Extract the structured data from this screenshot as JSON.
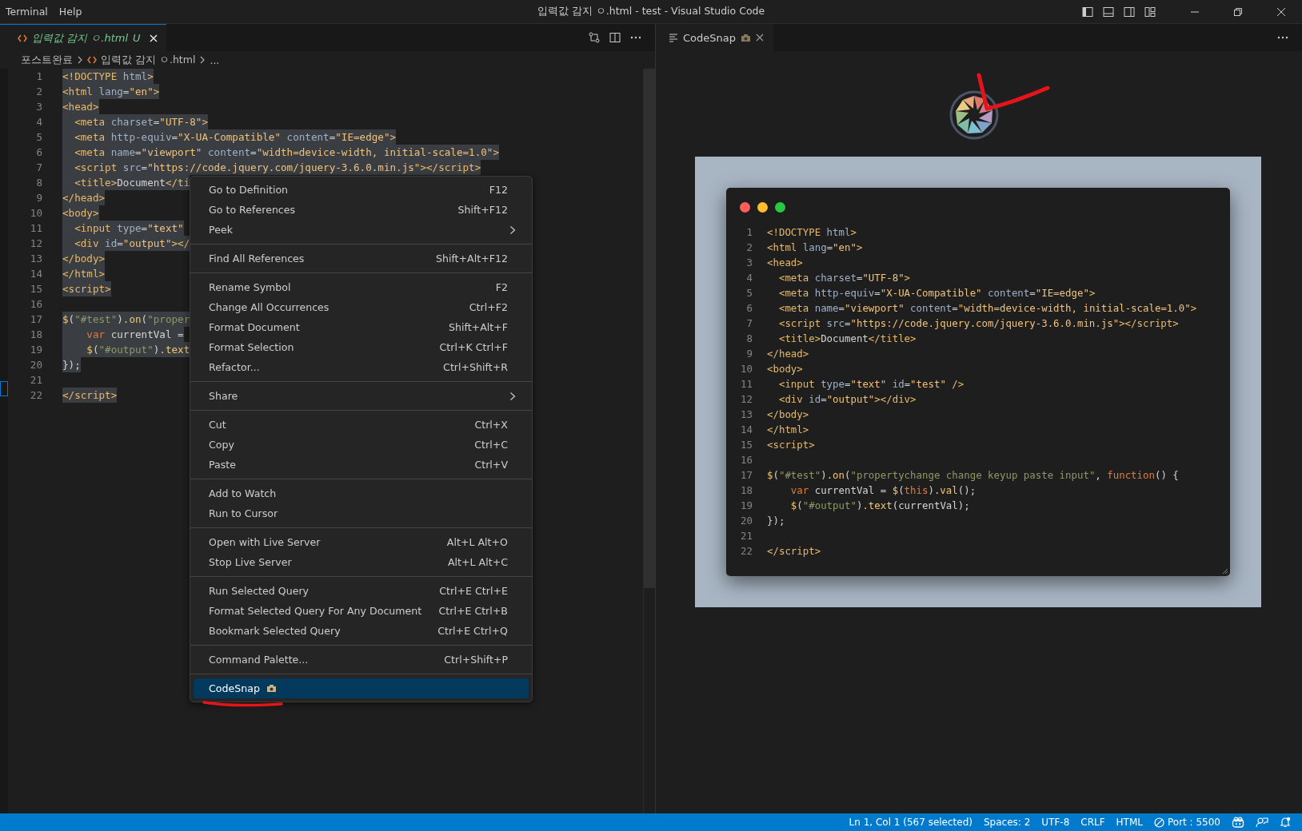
{
  "titlebar": {
    "menus": [
      "Terminal",
      "Help"
    ],
    "title": "입력값 감지 ㅇ.html - test - Visual Studio Code"
  },
  "editor": {
    "tab": {
      "label": "입력값 감지 ㅇ.html",
      "status": "U",
      "selected": true
    },
    "breadcrumb": [
      "포스트완료",
      "입력값 감지 ㅇ.html",
      "..."
    ],
    "selected": true,
    "lines": [
      {
        "n": "1",
        "tokens": [
          {
            "kind": "tag",
            "text": "<!DOCTYPE"
          },
          {
            "kind": "attr",
            "text": " html"
          },
          {
            "kind": "tag",
            "text": ">"
          }
        ]
      },
      {
        "n": "2",
        "tokens": [
          {
            "kind": "tag",
            "text": "<html"
          },
          {
            "kind": "attr",
            "text": " lang"
          },
          {
            "kind": "plain",
            "text": "="
          },
          {
            "kind": "string",
            "text": "\"en\""
          },
          {
            "kind": "tag",
            "text": ">"
          }
        ]
      },
      {
        "n": "3",
        "tokens": [
          {
            "kind": "tag",
            "text": "<head>"
          }
        ]
      },
      {
        "n": "4",
        "tokens": [
          {
            "kind": "tag",
            "text": "  <meta"
          },
          {
            "kind": "attr",
            "text": " charset"
          },
          {
            "kind": "plain",
            "text": "="
          },
          {
            "kind": "string",
            "text": "\"UTF-8\""
          },
          {
            "kind": "tag",
            "text": ">"
          }
        ]
      },
      {
        "n": "5",
        "tokens": [
          {
            "kind": "tag",
            "text": "  <meta"
          },
          {
            "kind": "attr",
            "text": " http-equiv"
          },
          {
            "kind": "plain",
            "text": "="
          },
          {
            "kind": "string",
            "text": "\"X-UA-Compatible\""
          },
          {
            "kind": "attr",
            "text": " content"
          },
          {
            "kind": "plain",
            "text": "="
          },
          {
            "kind": "string",
            "text": "\"IE=edge\""
          },
          {
            "kind": "tag",
            "text": ">"
          }
        ]
      },
      {
        "n": "6",
        "tokens": [
          {
            "kind": "tag",
            "text": "  <meta"
          },
          {
            "kind": "attr",
            "text": " name"
          },
          {
            "kind": "plain",
            "text": "="
          },
          {
            "kind": "string",
            "text": "\"viewport\""
          },
          {
            "kind": "attr",
            "text": " content"
          },
          {
            "kind": "plain",
            "text": "="
          },
          {
            "kind": "string",
            "text": "\"width=device-width, initial-scale=1.0\""
          },
          {
            "kind": "tag",
            "text": ">"
          }
        ]
      },
      {
        "n": "7",
        "tokens": [
          {
            "kind": "tag",
            "text": "  <script"
          },
          {
            "kind": "attr",
            "text": " src"
          },
          {
            "kind": "plain",
            "text": "="
          },
          {
            "kind": "string",
            "text": "\"https://code.jquery.com/jquery-3.6.0.min.js\""
          },
          {
            "kind": "tag",
            "text": "></script>"
          }
        ]
      },
      {
        "n": "8",
        "tokens": [
          {
            "kind": "tag",
            "text": "  <title>"
          },
          {
            "kind": "plain",
            "text": "Document"
          },
          {
            "kind": "tag",
            "text": "</ti"
          }
        ]
      },
      {
        "n": "9",
        "tokens": [
          {
            "kind": "tag",
            "text": "</head>"
          }
        ]
      },
      {
        "n": "10",
        "tokens": [
          {
            "kind": "tag",
            "text": "<body>"
          }
        ]
      },
      {
        "n": "11",
        "tokens": [
          {
            "kind": "tag",
            "text": "  <input"
          },
          {
            "kind": "attr",
            "text": " type"
          },
          {
            "kind": "plain",
            "text": "="
          },
          {
            "kind": "string",
            "text": "\"text\""
          }
        ]
      },
      {
        "n": "12",
        "tokens": [
          {
            "kind": "tag",
            "text": "  <div"
          },
          {
            "kind": "attr",
            "text": " id"
          },
          {
            "kind": "plain",
            "text": "="
          },
          {
            "kind": "string",
            "text": "\"output\""
          },
          {
            "kind": "tag",
            "text": "></"
          }
        ]
      },
      {
        "n": "13",
        "tokens": [
          {
            "kind": "tag",
            "text": "</body>"
          }
        ]
      },
      {
        "n": "14",
        "tokens": [
          {
            "kind": "tag",
            "text": "</html>"
          }
        ]
      },
      {
        "n": "15",
        "tokens": [
          {
            "kind": "tag",
            "text": "<script>"
          }
        ]
      },
      {
        "n": "16"
      },
      {
        "n": "17",
        "tokens": [
          {
            "kind": "method",
            "text": "$"
          },
          {
            "kind": "plain",
            "text": "("
          },
          {
            "kind": "jsstring",
            "text": "\"#test\""
          },
          {
            "kind": "plain",
            "text": ")"
          },
          {
            "kind": "method",
            "text": ".on"
          },
          {
            "kind": "plain",
            "text": "("
          },
          {
            "kind": "jsstring",
            "text": "\"proper"
          }
        ]
      },
      {
        "n": "18",
        "tokens": [
          {
            "kind": "keyword",
            "text": "    var"
          },
          {
            "kind": "plain",
            "text": " currentVal ="
          }
        ]
      },
      {
        "n": "19",
        "tokens": [
          {
            "kind": "method",
            "text": "    $"
          },
          {
            "kind": "plain",
            "text": "("
          },
          {
            "kind": "jsstring",
            "text": "\"#output\""
          },
          {
            "kind": "plain",
            "text": ")"
          },
          {
            "kind": "method",
            "text": ".text"
          }
        ]
      },
      {
        "n": "20",
        "tokens": [
          {
            "kind": "plain",
            "text": "});"
          }
        ]
      },
      {
        "n": "21"
      },
      {
        "n": "22",
        "tokens": [
          {
            "kind": "tag",
            "text": "</script>"
          }
        ]
      }
    ]
  },
  "context_menu": {
    "groups": [
      [
        {
          "label": "Go to Definition",
          "shortcut": "F12",
          "submenu": false,
          "selected": false
        },
        {
          "label": "Go to References",
          "shortcut": "Shift+F12",
          "submenu": false,
          "selected": false
        },
        {
          "label": "Peek",
          "submenu": true,
          "selected": false
        }
      ],
      [
        {
          "label": "Find All References",
          "shortcut": "Shift+Alt+F12",
          "submenu": false,
          "selected": false
        }
      ],
      [
        {
          "label": "Rename Symbol",
          "shortcut": "F2",
          "submenu": false,
          "selected": false
        },
        {
          "label": "Change All Occurrences",
          "shortcut": "Ctrl+F2",
          "submenu": false,
          "selected": false
        },
        {
          "label": "Format Document",
          "shortcut": "Shift+Alt+F",
          "submenu": false,
          "selected": false
        },
        {
          "label": "Format Selection",
          "shortcut": "Ctrl+K Ctrl+F",
          "submenu": false,
          "selected": false
        },
        {
          "label": "Refactor...",
          "shortcut": "Ctrl+Shift+R",
          "submenu": false,
          "selected": false
        }
      ],
      [
        {
          "label": "Share",
          "submenu": true,
          "selected": false
        }
      ],
      [
        {
          "label": "Cut",
          "shortcut": "Ctrl+X",
          "submenu": false,
          "selected": false
        },
        {
          "label": "Copy",
          "shortcut": "Ctrl+C",
          "submenu": false,
          "selected": false
        },
        {
          "label": "Paste",
          "shortcut": "Ctrl+V",
          "submenu": false,
          "selected": false
        }
      ],
      [
        {
          "label": "Add to Watch",
          "submenu": false,
          "selected": false
        },
        {
          "label": "Run to Cursor",
          "submenu": false,
          "selected": false
        }
      ],
      [
        {
          "label": "Open with Live Server",
          "shortcut": "Alt+L Alt+O",
          "submenu": false,
          "selected": false
        },
        {
          "label": "Stop Live Server",
          "shortcut": "Alt+L Alt+C",
          "submenu": false,
          "selected": false
        }
      ],
      [
        {
          "label": "Run Selected Query",
          "shortcut": "Ctrl+E Ctrl+E",
          "submenu": false,
          "selected": false
        },
        {
          "label": "Format Selected Query For Any Document",
          "shortcut": "Ctrl+E Ctrl+B",
          "submenu": false,
          "selected": false
        },
        {
          "label": "Bookmark Selected Query",
          "shortcut": "Ctrl+E Ctrl+Q",
          "submenu": false,
          "selected": false
        }
      ],
      [
        {
          "label": "Command Palette...",
          "shortcut": "Ctrl+Shift+P",
          "submenu": false,
          "selected": false
        }
      ],
      [
        {
          "label": "CodeSnap",
          "submenu": false,
          "selected": true,
          "icon": true
        }
      ]
    ]
  },
  "codesnap": {
    "tab": {
      "label": "CodeSnap",
      "selected": true
    },
    "lines": [
      {
        "n": "1",
        "tokens": [
          {
            "kind": "tag",
            "text": "<!DOCTYPE"
          },
          {
            "kind": "attr",
            "text": " html"
          },
          {
            "kind": "tag",
            "text": ">"
          }
        ]
      },
      {
        "n": "2",
        "tokens": [
          {
            "kind": "tag",
            "text": "<html"
          },
          {
            "kind": "attr",
            "text": " lang"
          },
          {
            "kind": "plain",
            "text": "="
          },
          {
            "kind": "string",
            "text": "\"en\""
          },
          {
            "kind": "tag",
            "text": ">"
          }
        ]
      },
      {
        "n": "3",
        "tokens": [
          {
            "kind": "tag",
            "text": "<head>"
          }
        ]
      },
      {
        "n": "4",
        "tokens": [
          {
            "kind": "tag",
            "text": "  <meta"
          },
          {
            "kind": "attr",
            "text": " charset"
          },
          {
            "kind": "plain",
            "text": "="
          },
          {
            "kind": "string",
            "text": "\"UTF-8\""
          },
          {
            "kind": "tag",
            "text": ">"
          }
        ]
      },
      {
        "n": "5",
        "tokens": [
          {
            "kind": "tag",
            "text": "  <meta"
          },
          {
            "kind": "attr",
            "text": " http-equiv"
          },
          {
            "kind": "plain",
            "text": "="
          },
          {
            "kind": "string",
            "text": "\"X-UA-Compatible\""
          },
          {
            "kind": "attr",
            "text": " content"
          },
          {
            "kind": "plain",
            "text": "="
          },
          {
            "kind": "string",
            "text": "\"IE=edge\""
          },
          {
            "kind": "tag",
            "text": ">"
          }
        ]
      },
      {
        "n": "6",
        "tokens": [
          {
            "kind": "tag",
            "text": "  <meta"
          },
          {
            "kind": "attr",
            "text": " name"
          },
          {
            "kind": "plain",
            "text": "="
          },
          {
            "kind": "string",
            "text": "\"viewport\""
          },
          {
            "kind": "attr",
            "text": " content"
          },
          {
            "kind": "plain",
            "text": "="
          },
          {
            "kind": "string",
            "text": "\"width=device-width, initial-scale=1.0\""
          },
          {
            "kind": "tag",
            "text": ">"
          }
        ]
      },
      {
        "n": "7",
        "tokens": [
          {
            "kind": "tag",
            "text": "  <script"
          },
          {
            "kind": "attr",
            "text": " src"
          },
          {
            "kind": "plain",
            "text": "="
          },
          {
            "kind": "string",
            "text": "\"https://code.jquery.com/jquery-3.6.0.min.js\""
          },
          {
            "kind": "tag",
            "text": "></script>"
          }
        ]
      },
      {
        "n": "8",
        "tokens": [
          {
            "kind": "tag",
            "text": "  <title>"
          },
          {
            "kind": "plain",
            "text": "Document"
          },
          {
            "kind": "tag",
            "text": "</title>"
          }
        ]
      },
      {
        "n": "9",
        "tokens": [
          {
            "kind": "tag",
            "text": "</head>"
          }
        ]
      },
      {
        "n": "10",
        "tokens": [
          {
            "kind": "tag",
            "text": "<body>"
          }
        ]
      },
      {
        "n": "11",
        "tokens": [
          {
            "kind": "tag",
            "text": "  <input"
          },
          {
            "kind": "attr",
            "text": " type"
          },
          {
            "kind": "plain",
            "text": "="
          },
          {
            "kind": "string",
            "text": "\"text\""
          },
          {
            "kind": "attr",
            "text": " id"
          },
          {
            "kind": "plain",
            "text": "="
          },
          {
            "kind": "string",
            "text": "\"test\""
          },
          {
            "kind": "tag",
            "text": " />"
          }
        ]
      },
      {
        "n": "12",
        "tokens": [
          {
            "kind": "tag",
            "text": "  <div"
          },
          {
            "kind": "attr",
            "text": " id"
          },
          {
            "kind": "plain",
            "text": "="
          },
          {
            "kind": "string",
            "text": "\"output\""
          },
          {
            "kind": "tag",
            "text": "></div>"
          }
        ]
      },
      {
        "n": "13",
        "tokens": [
          {
            "kind": "tag",
            "text": "</body>"
          }
        ]
      },
      {
        "n": "14",
        "tokens": [
          {
            "kind": "tag",
            "text": "</html>"
          }
        ]
      },
      {
        "n": "15",
        "tokens": [
          {
            "kind": "tag",
            "text": "<script>"
          }
        ]
      },
      {
        "n": "16"
      },
      {
        "n": "17",
        "tokens": [
          {
            "kind": "method",
            "text": "$"
          },
          {
            "kind": "plain",
            "text": "("
          },
          {
            "kind": "jsstring",
            "text": "\"#test\""
          },
          {
            "kind": "plain",
            "text": ")"
          },
          {
            "kind": "method",
            "text": ".on"
          },
          {
            "kind": "plain",
            "text": "("
          },
          {
            "kind": "jsstring",
            "text": "\"propertychange change keyup paste input\""
          },
          {
            "kind": "plain",
            "text": ","
          },
          {
            "kind": "keyword",
            "text": " function"
          },
          {
            "kind": "plain",
            "text": "() {"
          }
        ]
      },
      {
        "n": "18",
        "tokens": [
          {
            "kind": "keyword",
            "text": "    var"
          },
          {
            "kind": "plain",
            "text": " currentVal ="
          },
          {
            "kind": "method",
            "text": " $"
          },
          {
            "kind": "plain",
            "text": "("
          },
          {
            "kind": "keyword",
            "text": "this"
          },
          {
            "kind": "plain",
            "text": ")"
          },
          {
            "kind": "method",
            "text": ".val"
          },
          {
            "kind": "plain",
            "text": "();"
          }
        ]
      },
      {
        "n": "19",
        "tokens": [
          {
            "kind": "method",
            "text": "    $"
          },
          {
            "kind": "plain",
            "text": "("
          },
          {
            "kind": "jsstring",
            "text": "\"#output\""
          },
          {
            "kind": "plain",
            "text": ")"
          },
          {
            "kind": "method",
            "text": ".text"
          },
          {
            "kind": "plain",
            "text": "(currentVal);"
          }
        ]
      },
      {
        "n": "20",
        "tokens": [
          {
            "kind": "plain",
            "text": "});"
          }
        ]
      },
      {
        "n": "21"
      },
      {
        "n": "22",
        "tokens": [
          {
            "kind": "tag",
            "text": "</script>"
          }
        ]
      }
    ]
  },
  "status_bar": {
    "items": [
      "Ln 1, Col 1 (567 selected)",
      "Spaces: 2",
      "UTF-8",
      "CRLF",
      "HTML"
    ],
    "port": "Port : 5500"
  }
}
